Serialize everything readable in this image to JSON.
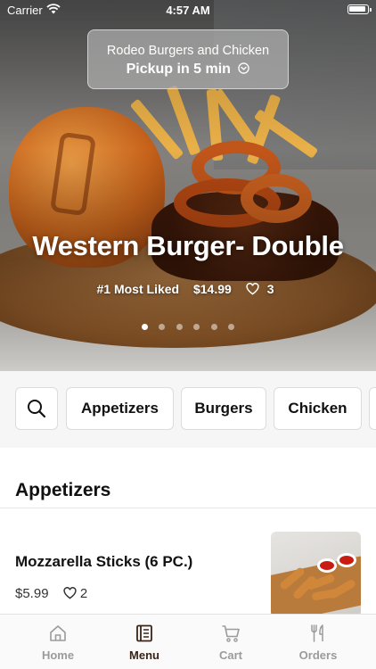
{
  "status_bar": {
    "carrier": "Carrier",
    "time": "4:57 AM"
  },
  "pickup": {
    "store_name": "Rodeo Burgers and Chicken",
    "pickup_text": "Pickup in 5 min"
  },
  "hero": {
    "title": "Western Burger- Double",
    "badge": "#1 Most Liked",
    "price": "$14.99",
    "likes": "3",
    "slide_count": 6,
    "active_slide": 1
  },
  "categories": {
    "items": [
      "Appetizers",
      "Burgers",
      "Chicken"
    ]
  },
  "section": {
    "title": "Appetizers"
  },
  "menu_item": {
    "name": "Mozzarella Sticks (6 PC.)",
    "price": "$5.99",
    "likes": "2"
  },
  "tabs": [
    {
      "label": "Home",
      "icon": "home-icon",
      "active": false
    },
    {
      "label": "Menu",
      "icon": "menu-icon",
      "active": true
    },
    {
      "label": "Cart",
      "icon": "cart-icon",
      "active": false
    },
    {
      "label": "Orders",
      "icon": "orders-icon",
      "active": false
    }
  ],
  "colors": {
    "active_tab": "#3a2418",
    "inactive_tab": "#9b9b9b",
    "background": "#f6f6f6"
  }
}
